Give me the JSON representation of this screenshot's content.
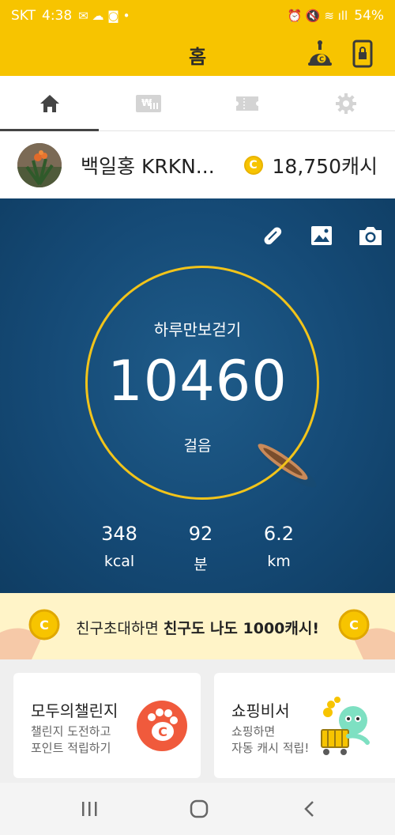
{
  "status_bar": {
    "carrier": "SKT",
    "time": "4:38",
    "battery": "54%"
  },
  "app_bar": {
    "title": "홈"
  },
  "tabs": [
    {
      "name": "home",
      "icon": "home-icon",
      "active": true
    },
    {
      "name": "shop",
      "icon": "shop-icon",
      "active": false
    },
    {
      "name": "ticket",
      "icon": "ticket-icon",
      "active": false
    },
    {
      "name": "settings",
      "icon": "gear-icon",
      "active": false
    }
  ],
  "profile": {
    "name": "백일홍 KRKN...",
    "cash": "18,750캐시",
    "coin_symbol": "C"
  },
  "hero": {
    "label": "하루만보걷기",
    "steps": "10460",
    "unit": "걸음",
    "stats": [
      {
        "value": "348",
        "unit": "kcal"
      },
      {
        "value": "92",
        "unit": "분"
      },
      {
        "value": "6.2",
        "unit": "km"
      }
    ]
  },
  "banner": {
    "text_normal": "친구초대하면 ",
    "text_bold": "친구도 나도 1000캐시!"
  },
  "cards": [
    {
      "title": "모두의챌린지",
      "subtitle_line1": "챌린지 도전하고",
      "subtitle_line2": "포인트 적립하기"
    },
    {
      "title": "쇼핑비서",
      "subtitle_line1": "쇼핑하면",
      "subtitle_line2": "자동 캐시 적립!"
    }
  ],
  "colors": {
    "brand_yellow": "#f7c400",
    "hero_blue": "#154a76",
    "ring": "#f2c41a",
    "challenge_orange": "#f05a3c"
  }
}
